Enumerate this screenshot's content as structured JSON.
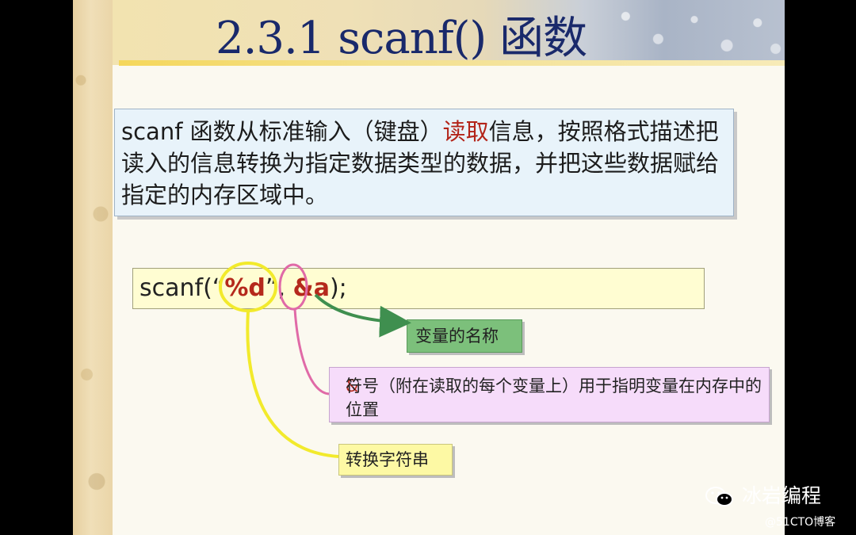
{
  "slide": {
    "title": "2.3.1 scanf() 函数",
    "description": {
      "before": "scanf 函数从标准输入（键盘）",
      "highlight": "读取",
      "after": "信息，按照格式描述把读入的信息转换为指定数据类型的数据，并把这些数据赋给指定的内存区域中。"
    },
    "code": {
      "prefix": "scanf(",
      "quote_open": "“",
      "format": "%d",
      "quote_close": "”",
      "comma": ", ",
      "amp": "&",
      "var": "a",
      "suffix": ");"
    },
    "annotations": {
      "variable_name": "变量的名称",
      "ampersand_symbol": "&",
      "ampersand_text": "符号（附在读取的每个变量上）用于指明变量在内存中的位置",
      "conversion_string": "转换字符串"
    },
    "colors": {
      "title": "#19296b",
      "highlight_red": "#b32419",
      "yellow_circle": "#f2ea2c",
      "pink_circle": "#e06aa7",
      "green_arrow": "#3f8f4f"
    }
  },
  "watermark": {
    "badge": "冰岩编程",
    "icon": "wechat-icon",
    "site": "@51CTO博客"
  }
}
